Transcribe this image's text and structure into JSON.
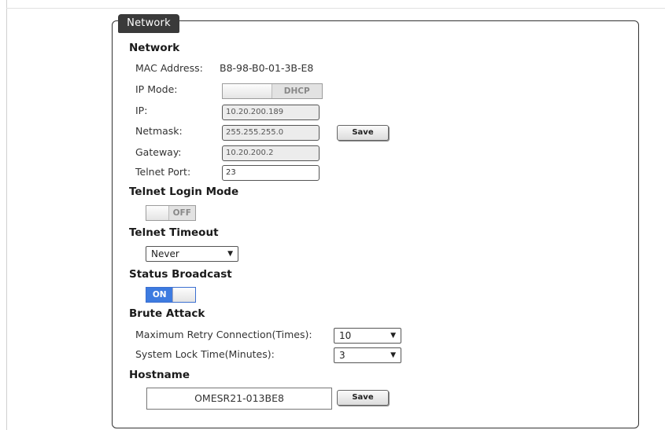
{
  "panel": {
    "tab_title": "Network"
  },
  "network": {
    "heading": "Network",
    "mac_label": "MAC Address:",
    "mac_value": "B8-98-B0-01-3B-E8",
    "ip_mode_label": "IP Mode:",
    "ip_mode_value": "DHCP",
    "ip_label": "IP:",
    "ip_value": "10.20.200.189",
    "netmask_label": "Netmask:",
    "netmask_value": "255.255.255.0",
    "gateway_label": "Gateway:",
    "gateway_value": "10.20.200.2",
    "telnet_port_label": "Telnet Port:",
    "telnet_port_value": "23",
    "save_label": "Save"
  },
  "telnet_login": {
    "heading": "Telnet Login Mode",
    "state": "OFF"
  },
  "telnet_timeout": {
    "heading": "Telnet Timeout",
    "selected": "Never"
  },
  "status_broadcast": {
    "heading": "Status Broadcast",
    "state": "ON"
  },
  "brute_attack": {
    "heading": "Brute Attack",
    "retry_label": "Maximum Retry Connection(Times):",
    "retry_value": "10",
    "lock_label": "System Lock Time(Minutes):",
    "lock_value": "3"
  },
  "hostname": {
    "heading": "Hostname",
    "value": "OMESR21-013BE8",
    "save_label": "Save"
  },
  "colors": {
    "tab_bg": "#3a3a3a",
    "toggle_on": "#3d7be0"
  },
  "icons": {
    "dropdown": "triangle-down-icon"
  }
}
